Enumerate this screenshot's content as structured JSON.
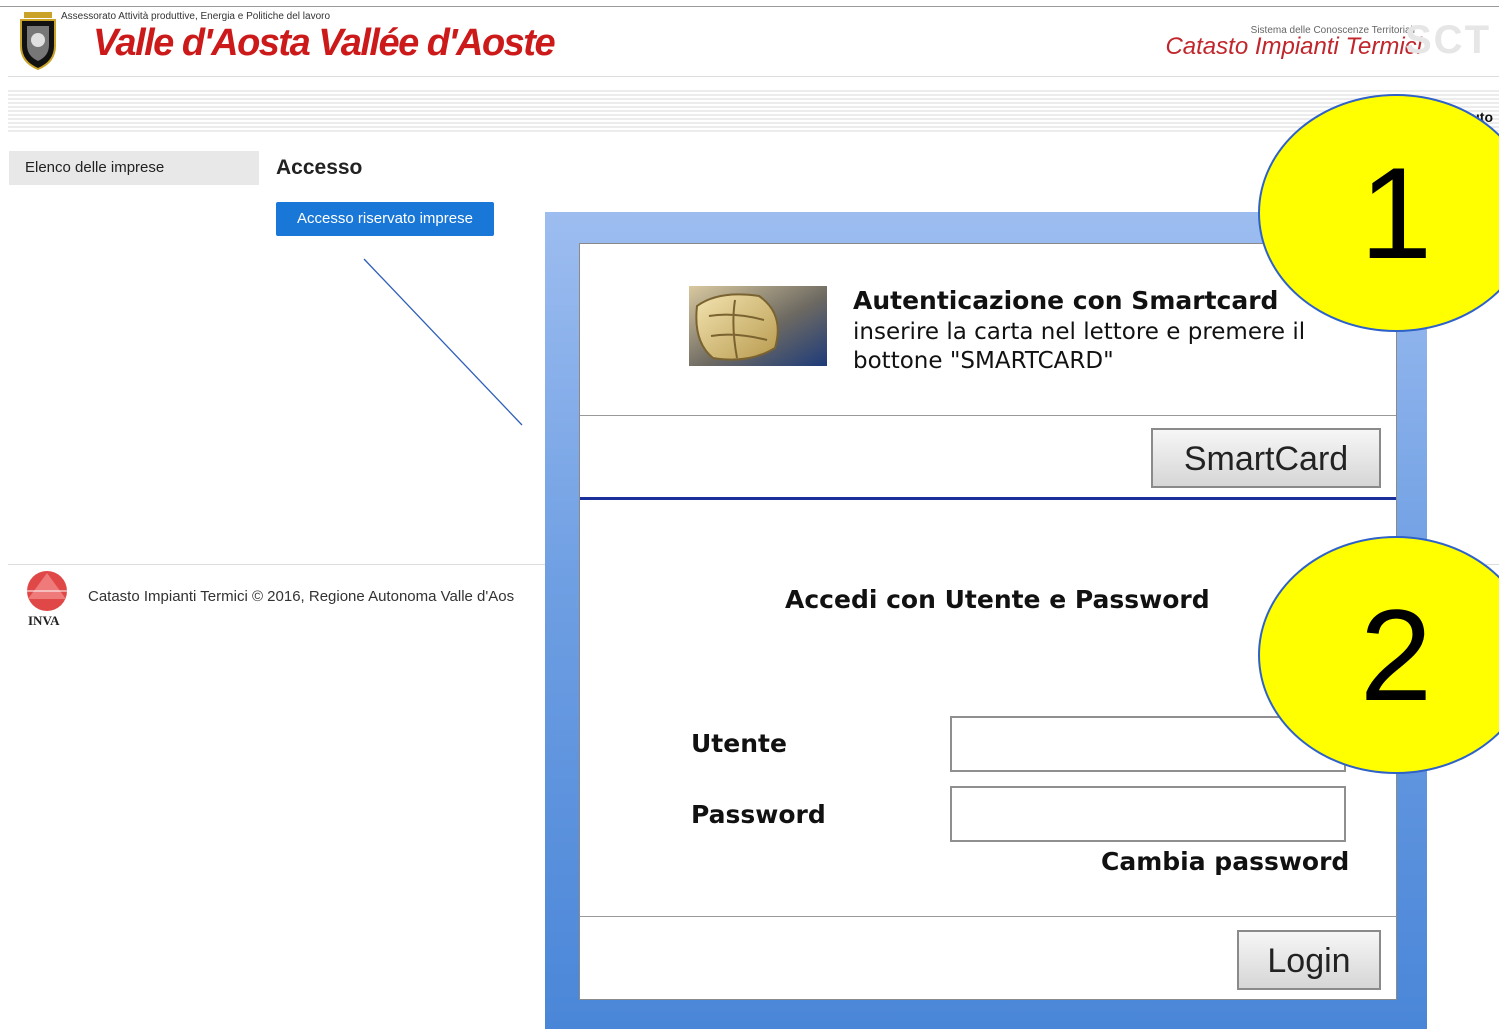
{
  "header": {
    "department": "Assessorato Attività produttive, Energia e Politiche del lavoro",
    "logo_text": "Valle d'Aosta Vallée d'Aoste",
    "sct_subtitle": "Sistema delle Conoscenze Territoriali",
    "sct_title": "Catasto Impianti Termici",
    "sct_letters": "SCT",
    "nav_right_text": "uto"
  },
  "sidebar": {
    "items": [
      {
        "label": "Elenco delle imprese"
      }
    ]
  },
  "main": {
    "title": "Accesso",
    "access_button": "Accesso riservato imprese"
  },
  "footer": {
    "logo_label": "INVA",
    "text": "Catasto Impianti Termici © 2016, Regione Autonoma Valle d'Aos"
  },
  "login": {
    "smartcard": {
      "title": "Autenticazione con Smartcard",
      "description": "inserire la carta nel lettore e premere il bottone \"SMARTCARD\"",
      "button": "SmartCard"
    },
    "userpass": {
      "title": "Accedi con Utente e Password",
      "user_label": "Utente",
      "user_value": "",
      "password_label": "Password",
      "password_value": "",
      "change_password": "Cambia password",
      "login_button": "Login"
    }
  },
  "annotations": [
    {
      "number": "1"
    },
    {
      "number": "2"
    }
  ],
  "colors": {
    "brand_red": "#cc1a1a",
    "primary_button": "#1977d8",
    "panel_frame": "#6f9fe3",
    "divider_blue": "#1a2f9a",
    "marker_fill": "#ffff00"
  }
}
